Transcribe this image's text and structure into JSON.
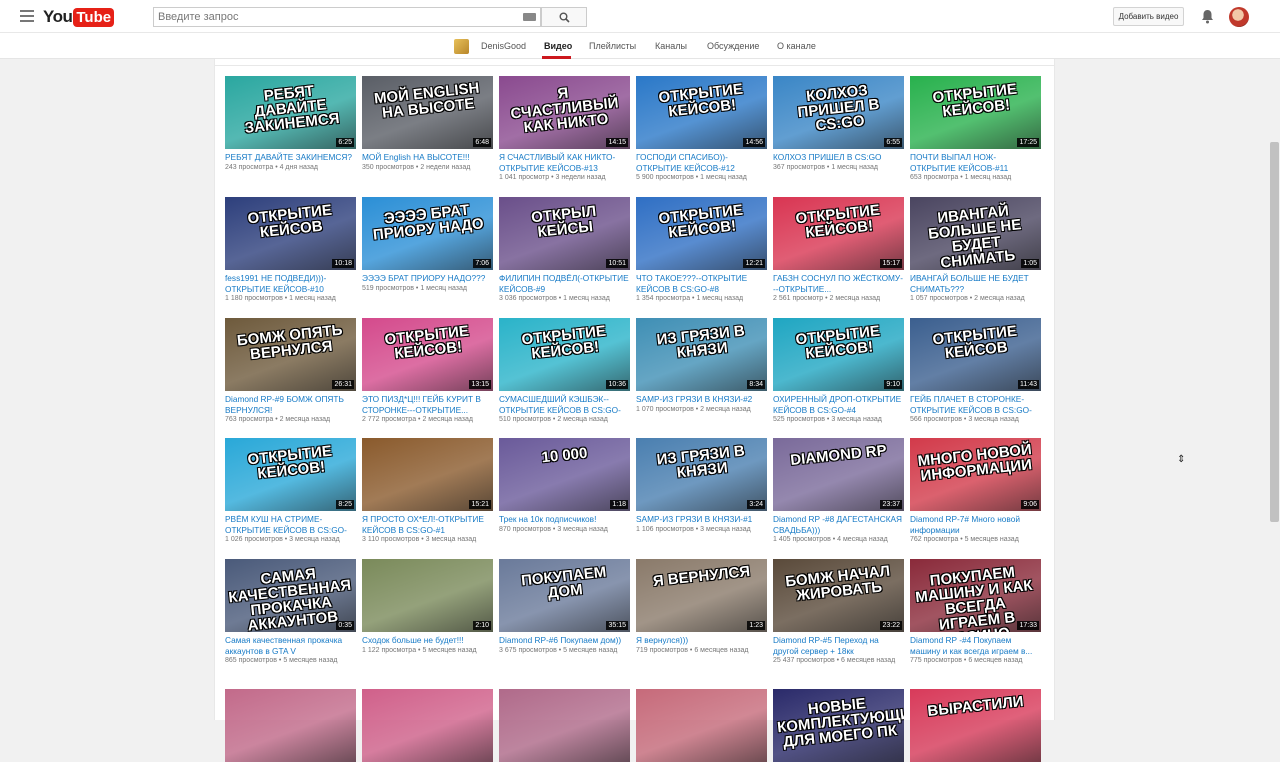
{
  "masthead": {
    "logo_you": "You",
    "logo_tube": "Tube",
    "search_placeholder": "Введите запрос",
    "upload_label": "Добавить видео"
  },
  "channel": {
    "name": "DenisGood",
    "tabs": [
      {
        "label": "Видео",
        "active": true
      },
      {
        "label": "Плейлисты"
      },
      {
        "label": "Каналы"
      },
      {
        "label": "Обсуждение"
      },
      {
        "label": "О канале"
      }
    ]
  },
  "videos": [
    {
      "title": "РЕБЯТ ДАВАЙТЕ ЗАКИНЕМСЯ?",
      "views": "243 просмотра",
      "age": "4 дня назад",
      "duration": "6:25",
      "thumb_text": "РЕБЯТ ДАВАЙТЕ ЗАКИНЕМСЯ",
      "color": "#2aa7a0"
    },
    {
      "title": "МОЙ English НА ВЫСОТЕ!!!",
      "views": "350 просмотров",
      "age": "2 недели назад",
      "duration": "6:48",
      "thumb_text": "МОЙ ENGLISH НА ВЫСОТЕ",
      "color": "#5a5e66"
    },
    {
      "title": "Я СЧАСТЛИВЫЙ КАК НИКТО-ОТКРЫТИЕ КЕЙСОВ-#13",
      "views": "1 041 просмотр",
      "age": "3 недели назад",
      "duration": "14:15",
      "thumb_text": "Я СЧАСТЛИВЫЙ КАК НИКТО",
      "color": "#8a4a8f"
    },
    {
      "title": "ГОСПОДИ СПАСИБО))-ОТКРЫТИЕ КЕЙСОВ-#12",
      "views": "5 900 просмотров",
      "age": "1 месяц назад",
      "duration": "14:56",
      "thumb_text": "ОТКРЫТИЕ КЕЙСОВ!",
      "color": "#2a78c8"
    },
    {
      "title": "КОЛХОЗ ПРИШЕЛ В CS:GO",
      "views": "367 просмотров",
      "age": "1 месяц назад",
      "duration": "6:55",
      "thumb_text": "КОЛХОЗ ПРИШЕЛ В CS:GO",
      "color": "#3a86c6"
    },
    {
      "title": "ПОЧТИ ВЫПАЛ НОЖ-ОТКРЫТИЕ КЕЙСОВ-#11",
      "views": "653 просмотра",
      "age": "1 месяц назад",
      "duration": "17:25",
      "thumb_text": "ОТКРЫТИЕ КЕЙСОВ!",
      "color": "#28b14d"
    },
    {
      "title": "fess1991 НЕ ПОДВЕДИ)))-ОТКРЫТИЕ КЕЙСОВ-#10",
      "views": "1 180 просмотров",
      "age": "1 месяц назад",
      "duration": "10:18",
      "thumb_text": "ОТКРЫТИЕ КЕЙСОВ",
      "color": "#2d3f7c"
    },
    {
      "title": "ЭЭЭЭ БРАТ ПРИОРУ НАДО???",
      "views": "519 просмотров",
      "age": "1 месяц назад",
      "duration": "7:06",
      "thumb_text": "ЭЭЭЭ БРАТ ПРИОРУ НАДО",
      "color": "#2b8fd6"
    },
    {
      "title": "ФИЛИПИН ПОДВЁЛ(-ОТКРЫТИЕ КЕЙСОВ-#9",
      "views": "3 036 просмотров",
      "age": "1 месяц назад",
      "duration": "10:51",
      "thumb_text": "ОТКРЫЛ КЕЙСЫ",
      "color": "#6a4f8a"
    },
    {
      "title": "ЧТО ТАКОЕ???--ОТКРЫТИЕ КЕЙСОВ В CS:GO-#8",
      "views": "1 354 просмотра",
      "age": "1 месяц назад",
      "duration": "12:21",
      "thumb_text": "ОТКРЫТИЕ КЕЙСОВ!",
      "color": "#2f6fc4"
    },
    {
      "title": "ГАБЗН СОСНУЛ ПО ЖЁСТКОМУ---ОТКРЫТИЕ...",
      "views": "2 561 просмотр",
      "age": "2 месяца назад",
      "duration": "15:17",
      "thumb_text": "ОТКРЫТИЕ КЕЙСОВ!",
      "color": "#d93552"
    },
    {
      "title": "ИВАНГАЙ БОЛЬШЕ НЕ БУДЕТ СНИМАТЬ???",
      "views": "1 057 просмотров",
      "age": "2 месяца назад",
      "duration": "1:05",
      "thumb_text": "ИВАНГАЙ БОЛЬШЕ НЕ БУДЕТ СНИМАТЬ",
      "color": "#4a4560"
    },
    {
      "title": "Diamond RP-#9 БОМЖ ОПЯТЬ ВЕРНУЛСЯ!",
      "views": "763 просмотра",
      "age": "2 месяца назад",
      "duration": "26:31",
      "thumb_text": "БОМЖ ОПЯТЬ ВЕРНУЛСЯ",
      "color": "#6e5a3c"
    },
    {
      "title": "ЭТО ПИЗД*Ц!!! ГЕЙБ КУРИТ В СТОРОНКЕ---ОТКРЫТИЕ...",
      "views": "2 772 просмотра",
      "age": "2 месяца назад",
      "duration": "13:15",
      "thumb_text": "ОТКРЫТИЕ КЕЙСОВ!",
      "color": "#d44a8c"
    },
    {
      "title": "СУМАСШЕДШИЙ КЭШБЭК--ОТКРЫТИЕ КЕЙСОВ В CS:GO-#5",
      "views": "510 просмотров",
      "age": "2 месяца назад",
      "duration": "10:36",
      "thumb_text": "ОТКРЫТИЕ КЕЙСОВ!",
      "color": "#2ab3c9"
    },
    {
      "title": "SAMP-ИЗ ГРЯЗИ В КНЯЗИ-#2",
      "views": "1 070 просмотров",
      "age": "2 месяца назад",
      "duration": "8:34",
      "thumb_text": "ИЗ ГРЯЗИ В КНЯЗИ",
      "color": "#3f8fb5"
    },
    {
      "title": "ОХИРЕННЫЙ ДРОП-ОТКРЫТИЕ КЕЙСОВ В CS:GO-#4",
      "views": "525 просмотров",
      "age": "3 месяца назад",
      "duration": "9:10",
      "thumb_text": "ОТКРЫТИЕ КЕЙСОВ!",
      "color": "#1fa6c2"
    },
    {
      "title": "ГЕЙБ ПЛАЧЕТ В СТОРОНКЕ-ОТКРЫТИЕ КЕЙСОВ В CS:GO-#3",
      "views": "566 просмотров",
      "age": "3 месяца назад",
      "duration": "11:43",
      "thumb_text": "ОТКРЫТИЕ КЕЙСОВ",
      "color": "#3b5f8f"
    },
    {
      "title": "РВЁМ КУШ НА СТРИМЕ-ОТКРЫТИЕ КЕЙСОВ В CS:GO-#2",
      "views": "1 026 просмотров",
      "age": "3 месяца назад",
      "duration": "8:25",
      "thumb_text": "ОТКРЫТИЕ КЕЙСОВ!",
      "color": "#29a8d8"
    },
    {
      "title": "Я ПРОСТО ОХ*ЕЛ!-ОТКРЫТИЕ КЕЙСОВ В CS:GO-#1",
      "views": "3 110 просмотров",
      "age": "3 месяца назад",
      "duration": "15:21",
      "thumb_text": "",
      "color": "#8a5a2c"
    },
    {
      "title": "Трек на 10к подписчиков!",
      "views": "870 просмотров",
      "age": "3 месяца назад",
      "duration": "1:18",
      "thumb_text": "10 000",
      "color": "#6a5a9a"
    },
    {
      "title": "SAMP-ИЗ ГРЯЗИ В КНЯЗИ-#1",
      "views": "1 106 просмотров",
      "age": "3 месяца назад",
      "duration": "3:24",
      "thumb_text": "ИЗ ГРЯЗИ В КНЯЗИ",
      "color": "#4a7fb0"
    },
    {
      "title": "Diamond RP -#8 ДАГЕСТАНСКАЯ СВАДЬБА)))",
      "views": "1 405 просмотров",
      "age": "4 месяца назад",
      "duration": "23:37",
      "thumb_text": "DIAMOND RP",
      "color": "#7a6a9a"
    },
    {
      "title": "Diamond RP-7# Много новой информации",
      "views": "762 просмотра",
      "age": "5 месяцев назад",
      "duration": "9:06",
      "thumb_text": "МНОГО НОВОЙ ИНФОРМАЦИИ",
      "color": "#d23a4a"
    },
    {
      "title": "Самая качественная прокачка аккаунтов в GTA V",
      "views": "865 просмотров",
      "age": "5 месяцев назад",
      "duration": "0:35",
      "thumb_text": "САМАЯ КАЧЕСТВЕННАЯ ПРОКАЧКА АККАУНТОВ",
      "color": "#4a5a7a"
    },
    {
      "title": "Сходок больше не будет!!!",
      "views": "1 122 просмотра",
      "age": "5 месяцев назад",
      "duration": "2:10",
      "thumb_text": "",
      "color": "#7a8a5a"
    },
    {
      "title": "Diamond RP-#6 Покупаем дом))",
      "views": "3 675 просмотров",
      "age": "5 месяцев назад",
      "duration": "35:15",
      "thumb_text": "ПОКУПАЕМ ДОМ",
      "color": "#6a7a9a"
    },
    {
      "title": "Я вернулся)))",
      "views": "719 просмотров",
      "age": "6 месяцев назад",
      "duration": "1:23",
      "thumb_text": "Я ВЕРНУЛСЯ",
      "color": "#8a7a6a"
    },
    {
      "title": "Diamond RP-#5 Переход на другой сервер + 18кк",
      "views": "25 437 просмотров",
      "age": "6 месяцев назад",
      "duration": "23:22",
      "thumb_text": "БОМЖ НАЧАЛ ЖИРОВАТЬ",
      "color": "#5a4a3a"
    },
    {
      "title": "Diamond RP -#4 Покупаем машину и как всегда играем в...",
      "views": "775 просмотров",
      "age": "6 месяцев назад",
      "duration": "17:33",
      "thumb_text": "ПОКУПАЕМ МАШИНУ И КАК ВСЕГДА ИГРАЕМ В КАЗИНО",
      "color": "#8a2a3a"
    },
    {
      "title": "",
      "views": "",
      "age": "",
      "duration": "",
      "thumb_text": "",
      "color": "#c26a8a"
    },
    {
      "title": "",
      "views": "",
      "age": "",
      "duration": "",
      "thumb_text": "",
      "color": "#d0608a"
    },
    {
      "title": "",
      "views": "",
      "age": "",
      "duration": "",
      "thumb_text": "",
      "color": "#b06a8a"
    },
    {
      "title": "",
      "views": "",
      "age": "",
      "duration": "",
      "thumb_text": "",
      "color": "#c66a7a"
    },
    {
      "title": "",
      "views": "",
      "age": "",
      "duration": "",
      "thumb_text": "НОВЫЕ КОМПЛЕКТУЮЩИЕ ДЛЯ МОЕГО ПК",
      "color": "#2a2a6a"
    },
    {
      "title": "",
      "views": "",
      "age": "",
      "duration": "",
      "thumb_text": "ВЫРАСТИЛИ",
      "color": "#d83a5a"
    }
  ]
}
